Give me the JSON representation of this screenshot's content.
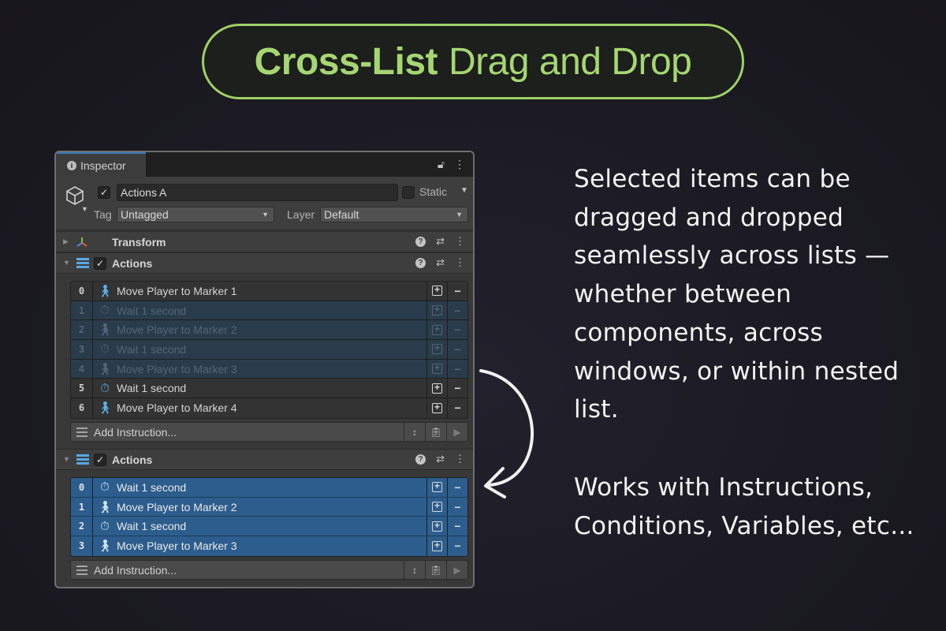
{
  "title": {
    "bold": "Cross-List",
    "rest": "Drag and Drop"
  },
  "description": {
    "paragraph1": "Selected items can be dragged and dropped seamlessly across lists —whether between components, across windows, or within nested list.",
    "paragraph2": "Works with Instructions, Conditions, Variables, etc..."
  },
  "colors": {
    "accent": "#9fd066",
    "selection": "#2c5d8d",
    "list_icon": "#57a8e6"
  },
  "inspector": {
    "tab_label": "Inspector",
    "object_name": "Actions A",
    "static_label": "Static",
    "tag_label": "Tag",
    "tag_value": "Untagged",
    "layer_label": "Layer",
    "layer_value": "Default",
    "transform": {
      "label": "Transform"
    },
    "components": [
      {
        "label": "Actions",
        "add_label": "Add Instruction...",
        "rows": [
          {
            "index": "0",
            "icon": "walk-icon",
            "text": "Move Player to Marker 1",
            "state": "normal"
          },
          {
            "index": "1",
            "icon": "timer-icon",
            "text": "Wait 1 second",
            "state": "dim"
          },
          {
            "index": "2",
            "icon": "walk-icon",
            "text": "Move Player to Marker 2",
            "state": "dim"
          },
          {
            "index": "3",
            "icon": "timer-icon",
            "text": "Wait 1 second",
            "state": "dim"
          },
          {
            "index": "4",
            "icon": "walk-icon",
            "text": "Move Player to Marker 3",
            "state": "dim"
          },
          {
            "index": "5",
            "icon": "timer-icon",
            "text": "Wait 1 second",
            "state": "normal"
          },
          {
            "index": "6",
            "icon": "walk-icon",
            "text": "Move Player to Marker 4",
            "state": "normal"
          }
        ]
      },
      {
        "label": "Actions",
        "add_label": "Add Instruction...",
        "rows": [
          {
            "index": "0",
            "icon": "timer-icon",
            "text": "Wait 1 second",
            "state": "selected"
          },
          {
            "index": "1",
            "icon": "walk-icon",
            "text": "Move Player to Marker 2",
            "state": "selected"
          },
          {
            "index": "2",
            "icon": "timer-icon",
            "text": "Wait 1 second",
            "state": "selected"
          },
          {
            "index": "3",
            "icon": "walk-icon",
            "text": "Move Player to Marker 3",
            "state": "selected"
          }
        ]
      }
    ]
  }
}
